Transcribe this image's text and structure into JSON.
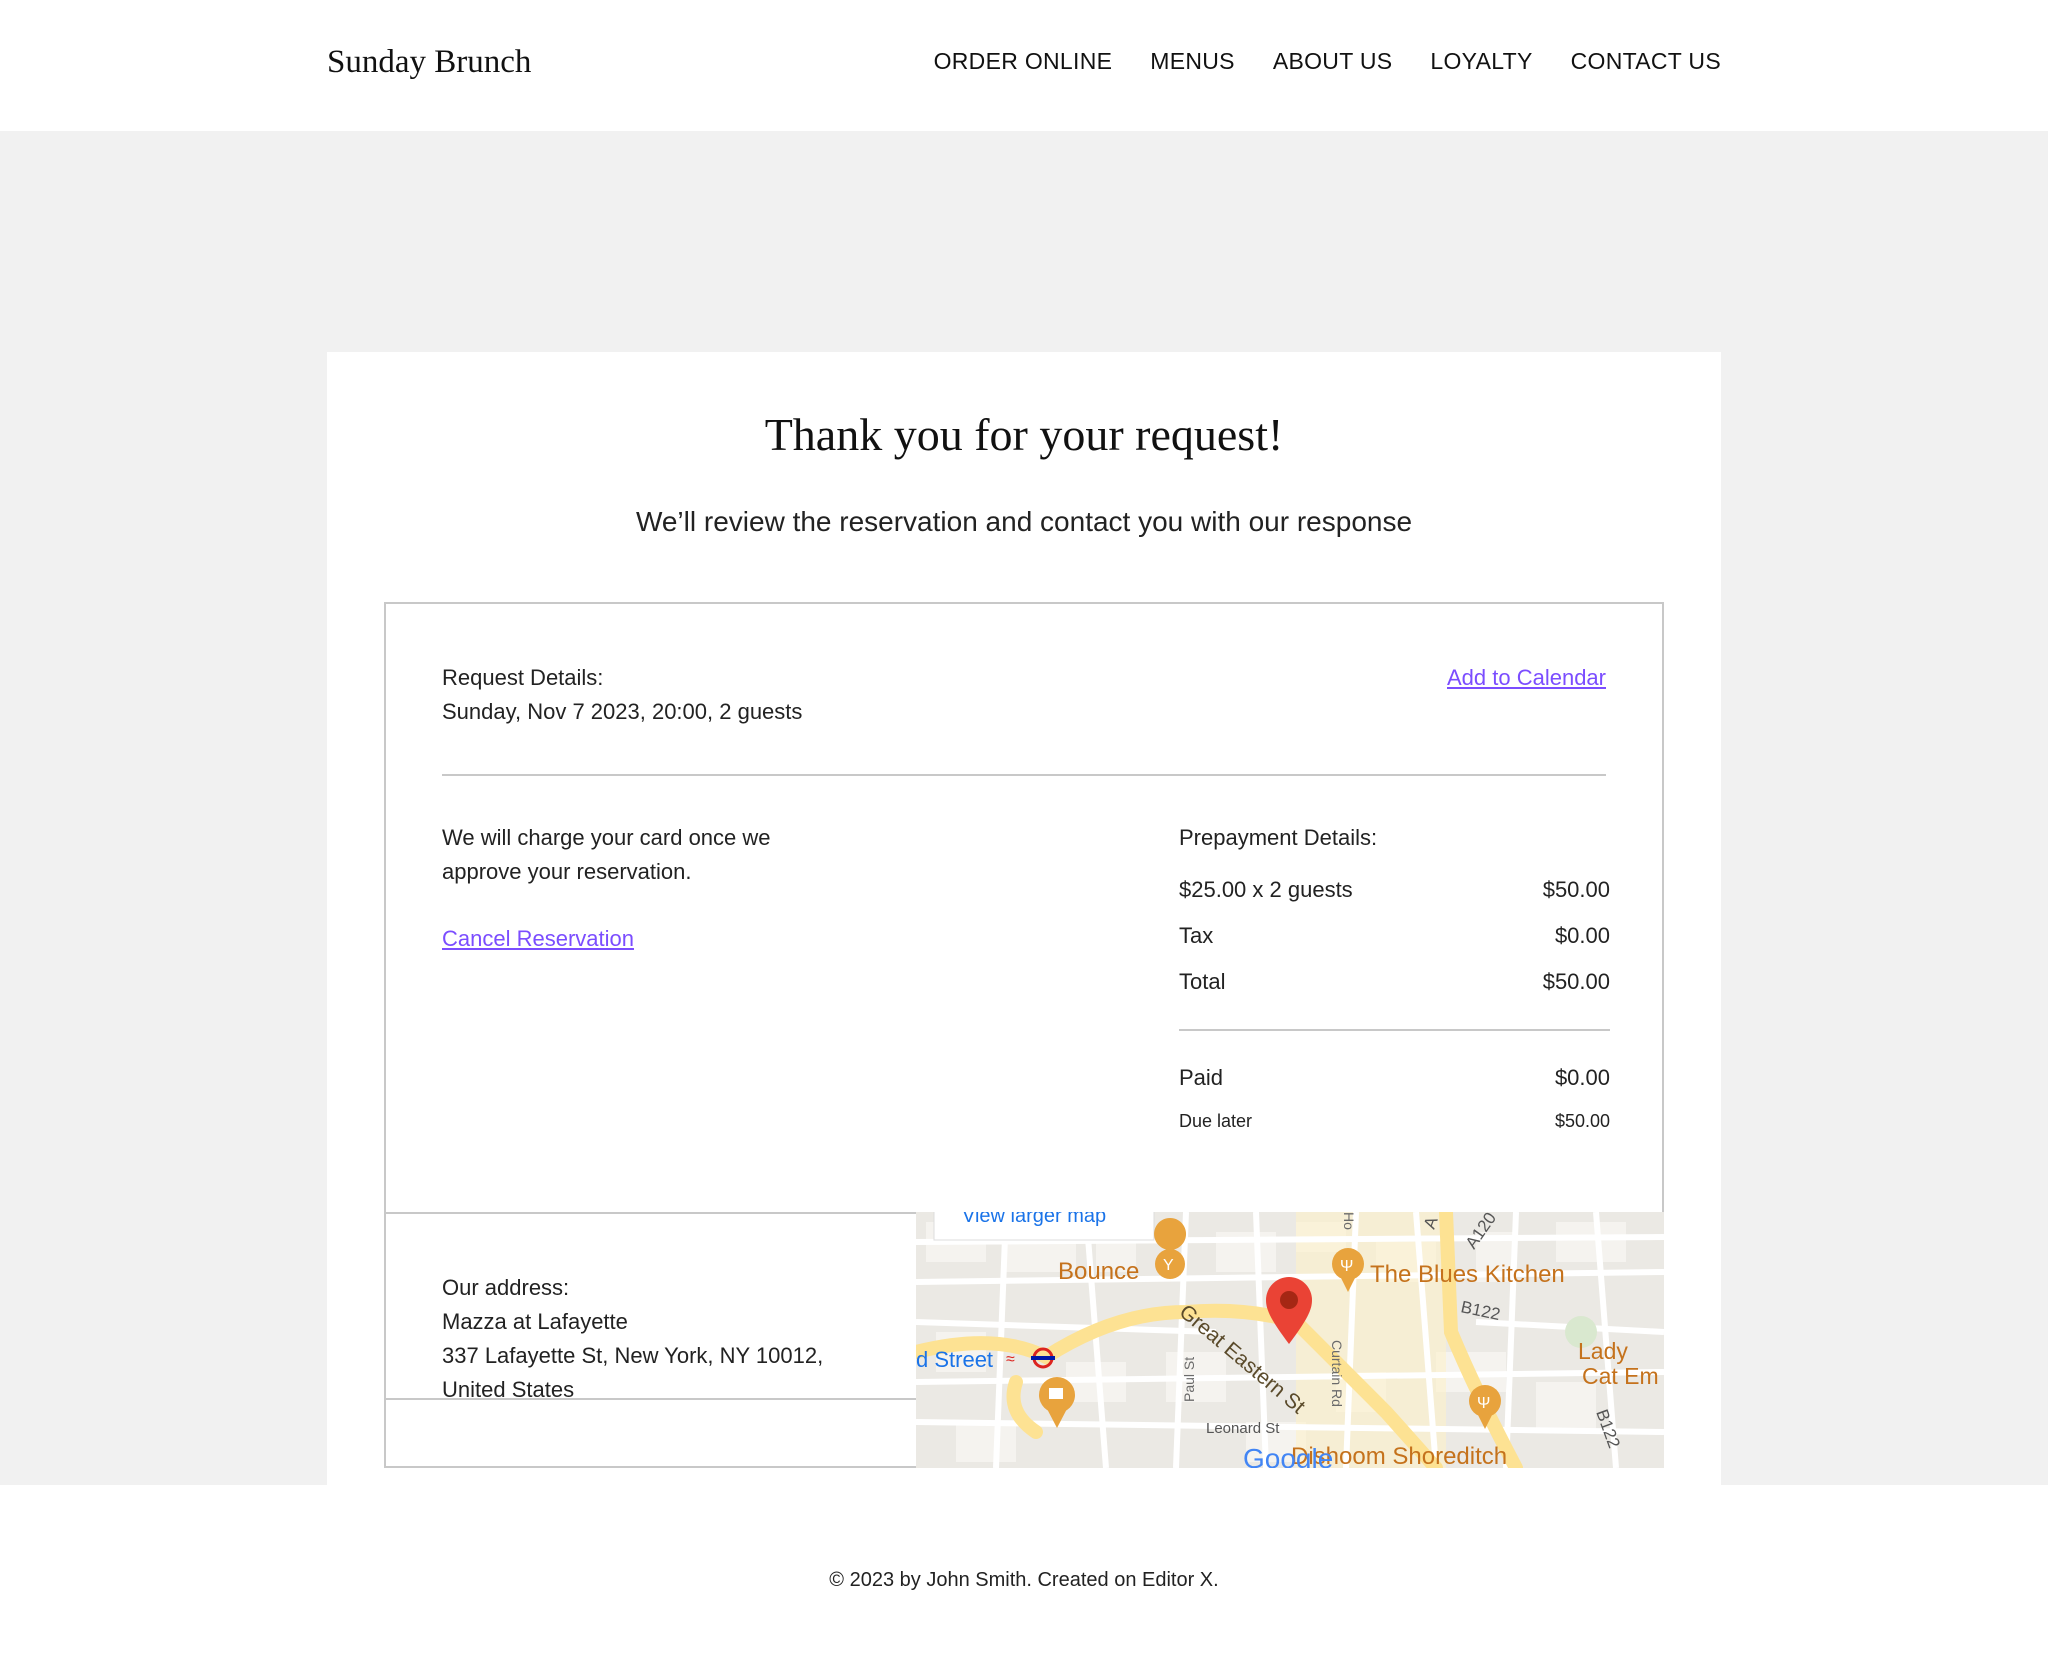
{
  "header": {
    "brand": "Sunday Brunch",
    "nav": [
      "ORDER ONLINE",
      "MENUS",
      "ABOUT US",
      "LOYALTY",
      "CONTACT US"
    ]
  },
  "main": {
    "title": "Thank you for your request!",
    "subtitle": "We’ll review the reservation and contact you with our response"
  },
  "request": {
    "label": "Request Details:",
    "value": "Sunday, Nov 7 2023, 20:00, 2 guests",
    "add_to_calendar": "Add to Calendar"
  },
  "charge": {
    "note_line1": "We will charge your card once we",
    "note_line2": "approve your reservation.",
    "cancel_link": "Cancel Reservation"
  },
  "prepayment": {
    "label": "Prepayment Details:",
    "rows": [
      {
        "label": "$25.00 x 2 guests",
        "amount": "$50.00"
      },
      {
        "label": "Tax",
        "amount": "$0.00"
      },
      {
        "label": "Total",
        "amount": "$50.00"
      }
    ],
    "paid": {
      "label": "Paid",
      "amount": "$0.00"
    },
    "due": {
      "label": "Due later",
      "amount": "$50.00"
    }
  },
  "address": {
    "label": "Our address:",
    "line1": "Mazza at Lafayette",
    "line2": "337 Lafayette St, New York, NY 10012,",
    "line3": "United States"
  },
  "map": {
    "view_larger": "View larger map",
    "labels": {
      "bounce": "Bounce",
      "blues_kitchen": "The Blues Kitchen",
      "street": "d Street",
      "great_eastern": "Great Eastern St",
      "lady": "Lady",
      "cat_em": "Cat Em",
      "paul_st": "Paul St",
      "curtain_rd": "Curtain Rd",
      "leonard_st": "Leonard St",
      "dishoom": "Dishoom Shoreditch",
      "b122_a": "B122",
      "b122_b": "B122",
      "a120": "A120",
      "a": "A",
      "ho": "Ho",
      "google": "Google"
    },
    "colors": {
      "road_major": "#fde293",
      "road_minor": "#ffffff",
      "marker": "#ea4335",
      "poi": "#e8a33d",
      "poi_text": "#c5721c"
    }
  },
  "footer": {
    "copyright": "© 2023 by John Smith. Created on Editor X."
  }
}
